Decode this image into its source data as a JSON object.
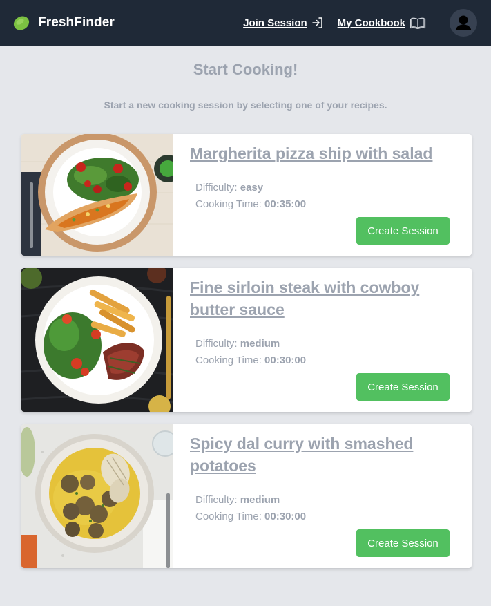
{
  "navbar": {
    "brand": "FreshFinder",
    "join_session_label": "Join Session",
    "my_cookbook_label": "My Cookbook"
  },
  "header": {
    "title": "Start Cooking!",
    "subtitle": "Start a new cooking session by selecting one of your recipes."
  },
  "labels": {
    "difficulty": "Difficulty:",
    "cooking_time": "Cooking Time:",
    "create_session": "Create Session"
  },
  "recipes": [
    {
      "title": "Margherita pizza ship with salad",
      "difficulty": "easy",
      "cooking_time": "00:35:00"
    },
    {
      "title": "Fine sirloin steak with cowboy butter sauce",
      "difficulty": "medium",
      "cooking_time": "00:30:00"
    },
    {
      "title": "Spicy dal curry with smashed potatoes",
      "difficulty": "medium",
      "cooking_time": "00:30:00"
    }
  ],
  "colors": {
    "navbar_bg": "#1f2937",
    "page_bg": "#e5e7eb",
    "accent_green": "#52c060",
    "muted_text": "#9ca3af"
  }
}
